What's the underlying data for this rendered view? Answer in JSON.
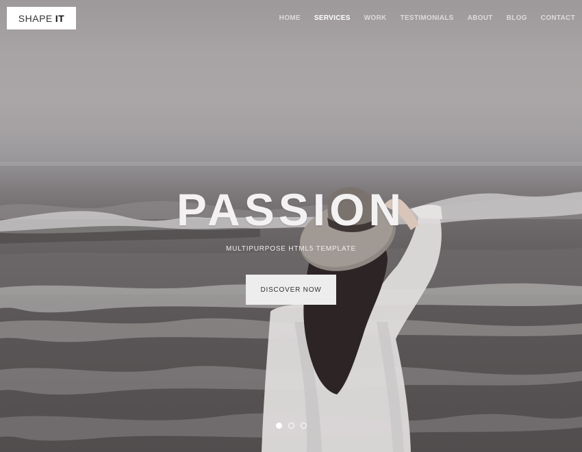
{
  "brand": {
    "logo_light": "SHAPE",
    "logo_bold": "IT"
  },
  "nav": {
    "items": [
      {
        "label": "HOME",
        "active": false
      },
      {
        "label": "SERVICES",
        "active": true
      },
      {
        "label": "WORK",
        "active": false
      },
      {
        "label": "TESTIMONIALS",
        "active": false
      },
      {
        "label": "ABOUT",
        "active": false
      },
      {
        "label": "BLOG",
        "active": false
      },
      {
        "label": "CONTACT",
        "active": false
      }
    ]
  },
  "hero": {
    "headline": "PASSION",
    "subline": "MULTIPURPOSE HTML5 TEMPLATE",
    "cta_label": "DISCOVER NOW",
    "background_image": "woman-in-hat-on-beach-photo"
  },
  "slider": {
    "slide_count": 3,
    "active_index": 0
  },
  "colors": {
    "text_light": "#f3f1f1",
    "button_bg": "#eeeded",
    "logo_bg": "#ffffff"
  }
}
